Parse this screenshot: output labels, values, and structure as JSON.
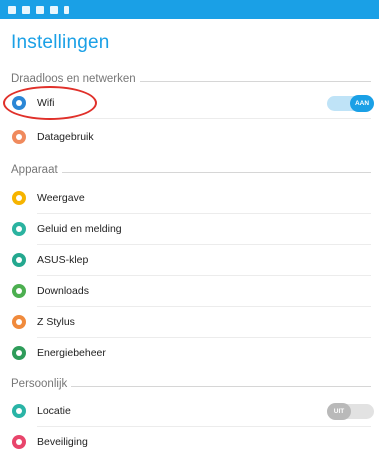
{
  "title": "Instellingen",
  "sections": [
    {
      "label": "Draadloos en netwerken",
      "items": [
        {
          "label": "Wifi",
          "icon": "wifi-icon",
          "color": "#2b87d6",
          "toggle": "AAN"
        },
        {
          "label": "Datagebruik",
          "icon": "data-usage-icon",
          "color": "#f08a5d"
        }
      ]
    },
    {
      "label": "Apparaat",
      "items": [
        {
          "label": "Weergave",
          "icon": "display-icon",
          "color": "#f6b400"
        },
        {
          "label": "Geluid en melding",
          "icon": "sound-icon",
          "color": "#2bb3a0"
        },
        {
          "label": "ASUS-klep",
          "icon": "cover-icon",
          "color": "#24a88f"
        },
        {
          "label": "Downloads",
          "icon": "download-icon",
          "color": "#4caf50"
        },
        {
          "label": "Z Stylus",
          "icon": "stylus-icon",
          "color": "#f08a3c"
        },
        {
          "label": "Energiebeheer",
          "icon": "battery-icon",
          "color": "#2e9c5a"
        }
      ]
    },
    {
      "label": "Persoonlijk",
      "items": [
        {
          "label": "Locatie",
          "icon": "location-icon",
          "color": "#2ab4a6",
          "toggle": "UIT"
        },
        {
          "label": "Beveiliging",
          "icon": "lock-icon",
          "color": "#e8456b"
        }
      ]
    }
  ],
  "colors": {
    "accent": "#1aa0e6",
    "highlight": "#e0302a"
  }
}
